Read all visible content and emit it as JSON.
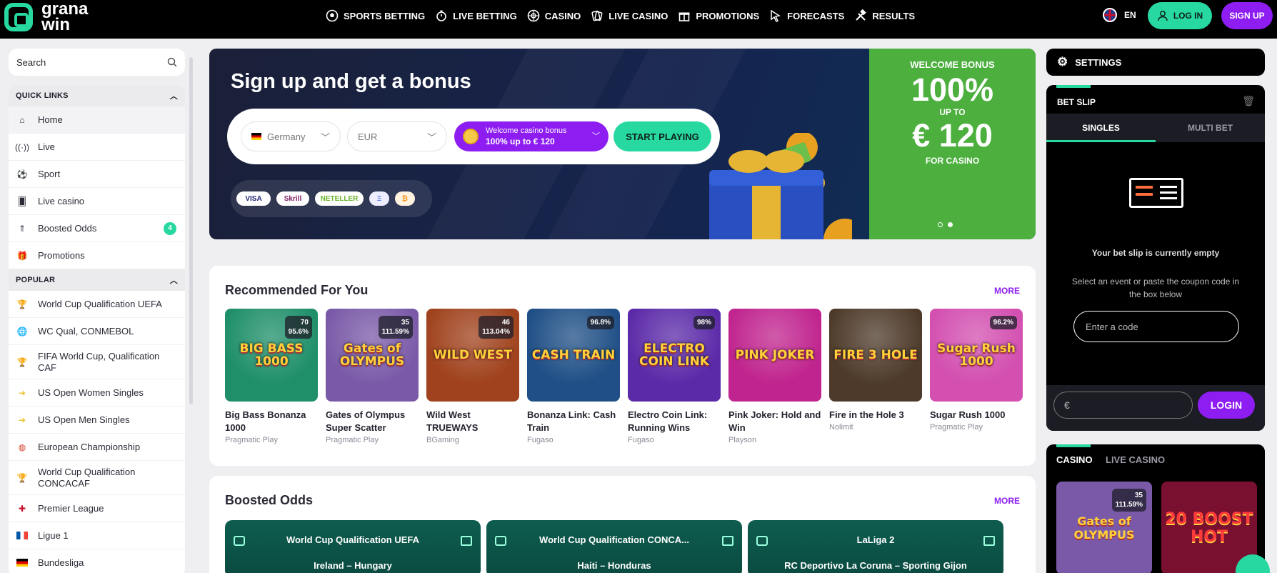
{
  "brand": {
    "line1": "grana",
    "line2": "win",
    "accent": "#27d8a0",
    "purple": "#8d1df1"
  },
  "nav": {
    "items": [
      {
        "label": "SPORTS BETTING",
        "icon": "soccer-ball-icon"
      },
      {
        "label": "LIVE BETTING",
        "icon": "stopwatch-icon"
      },
      {
        "label": "CASINO",
        "icon": "roulette-icon"
      },
      {
        "label": "LIVE CASINO",
        "icon": "cards-icon"
      },
      {
        "label": "PROMOTIONS",
        "icon": "gift-icon"
      },
      {
        "label": "FORECASTS",
        "icon": "cursor-icon"
      },
      {
        "label": "RESULTS",
        "icon": "hammer-icon"
      }
    ],
    "lang": "EN",
    "login": "LOG IN",
    "signup": "SIGN UP"
  },
  "sidebar": {
    "search_placeholder": "Search",
    "quick_links_title": "QUICK LINKS",
    "quick_links": [
      {
        "label": "Home",
        "icon": "home-icon"
      },
      {
        "label": "Live",
        "icon": "live-icon"
      },
      {
        "label": "Sport",
        "icon": "ball-icon"
      },
      {
        "label": "Live casino",
        "icon": "cards-icon"
      },
      {
        "label": "Boosted Odds",
        "icon": "boost-icon",
        "badge": "4"
      },
      {
        "label": "Promotions",
        "icon": "gift-icon"
      }
    ],
    "popular_title": "POPULAR",
    "popular": [
      {
        "label": "World Cup Qualification UEFA",
        "icon": "trophy-icon"
      },
      {
        "label": "WC Qual, CONMEBOL",
        "icon": "globe-icon"
      },
      {
        "label": "FIFA World Cup, Qualification CAF",
        "icon": "trophy-icon"
      },
      {
        "label": "US Open Women Singles",
        "icon": "tennis-icon"
      },
      {
        "label": "US Open Men Singles",
        "icon": "tennis-icon"
      },
      {
        "label": "European Championship",
        "icon": "globe-icon"
      },
      {
        "label": "World Cup Qualification CONCACAF",
        "icon": "trophy-icon"
      },
      {
        "label": "Premier League",
        "icon": "england-flag-icon"
      },
      {
        "label": "Ligue 1",
        "icon": "france-flag-icon"
      },
      {
        "label": "Bundesliga",
        "icon": "germany-flag-icon"
      }
    ]
  },
  "hero": {
    "title": "Sign up and get a bonus",
    "country": "Germany",
    "currency": "EUR",
    "bonus_line1": "Welcome casino bonus",
    "bonus_line2": "100% up to € 120",
    "start": "START PLAYING",
    "payments": [
      "VISA",
      "Skrill",
      "NETELLER",
      "Ξ",
      "₿"
    ],
    "panel": {
      "t1": "WELCOME BONUS",
      "t2": "100%",
      "t3": "UP TO",
      "t4": "€ 120",
      "t5": "FOR CASINO"
    }
  },
  "recommended": {
    "title": "Recommended For You",
    "more": "MORE",
    "games": [
      {
        "name": "Big Bass Bonanza 1000",
        "provider": "Pragmatic Play",
        "art": "BIG BASS 1000",
        "rtp_count": "70",
        "rtp": "95.6%",
        "bg": "#1f8f6a"
      },
      {
        "name": "Gates of Olympus Super Scatter",
        "provider": "Pragmatic Play",
        "art": "Gates of OLYMPUS",
        "rtp_count": "35",
        "rtp": "111.59%",
        "bg": "#7a5aa8"
      },
      {
        "name": "Wild West TRUEWAYS",
        "provider": "BGaming",
        "art": "WILD WEST",
        "rtp_count": "46",
        "rtp": "113.04%",
        "bg": "#a0421d"
      },
      {
        "name": "Bonanza Link: Cash Train",
        "provider": "Fugaso",
        "art": "CASH TRAIN",
        "rtp_count": "",
        "rtp": "96.8%",
        "bg": "#1f4f86"
      },
      {
        "name": "Electro Coin Link: Running Wins",
        "provider": "Fugaso",
        "art": "ELECTRO COIN LINK",
        "rtp_count": "",
        "rtp": "98%",
        "bg": "#5b2aa8"
      },
      {
        "name": "Pink Joker: Hold and Win",
        "provider": "Playson",
        "art": "PINK JOKER",
        "rtp_count": "",
        "rtp": "",
        "bg": "#c0248e"
      },
      {
        "name": "Fire in the Hole 3",
        "provider": "Nolimit",
        "art": "FIRE 3 HOLE",
        "rtp_count": "",
        "rtp": "",
        "bg": "#4d3a2a"
      },
      {
        "name": "Sugar Rush 1000",
        "provider": "Pragmatic Play",
        "art": "Sugar Rush 1000",
        "rtp_count": "",
        "rtp": "96.2%",
        "bg": "#d34fb0"
      }
    ]
  },
  "boosted": {
    "title": "Boosted Odds",
    "more": "MORE",
    "cards": [
      {
        "league": "World Cup Qualification UEFA",
        "match": "Ireland – Hungary"
      },
      {
        "league": "World Cup Qualification CONCA...",
        "match": "Haiti – Honduras"
      },
      {
        "league": "LaLiga 2",
        "match": "RC Deportivo La Coruna – Sporting Gijon"
      }
    ]
  },
  "right": {
    "settings": "SETTINGS",
    "betslip_title": "BET SLIP",
    "tab_singles": "SINGLES",
    "tab_multi": "MULTI BET",
    "empty": "Your bet slip is currently empty",
    "hint": "Select an event or paste the coupon code in the box below",
    "code_placeholder": "Enter a code",
    "amount_placeholder": "€",
    "login": "LOGIN",
    "casino_tab": "CASINO",
    "live_casino_tab": "LIVE CASINO",
    "casino_games": [
      {
        "art": "Gates of OLYMPUS",
        "rtp_count": "35",
        "rtp": "111.59%",
        "bg": "#7a5aa8"
      },
      {
        "art": "20 BOOST HOT",
        "rtp_count": "",
        "rtp": "",
        "bg": "#7a1030"
      }
    ]
  }
}
